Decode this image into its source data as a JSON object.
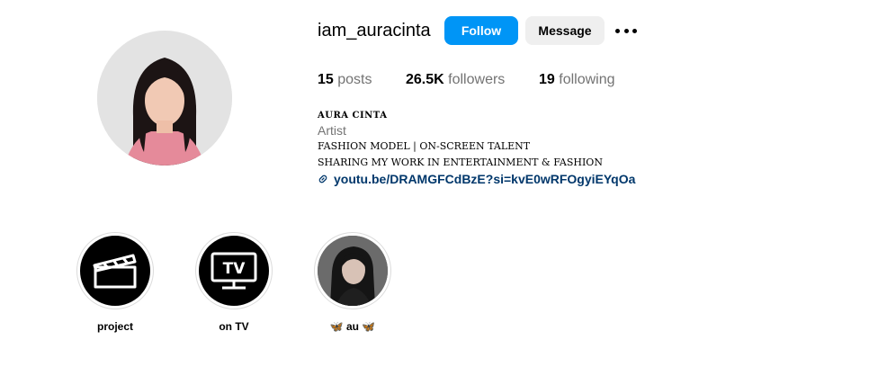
{
  "profile": {
    "username": "iam_auracinta",
    "follow_label": "Follow",
    "message_label": "Message"
  },
  "stats": {
    "posts_count": "15",
    "posts_label": "posts",
    "followers_count": "26.5K",
    "followers_label": "followers",
    "following_count": "19",
    "following_label": "following"
  },
  "bio": {
    "name": "AURA CINTA",
    "category": "Artist",
    "line1": "FASHION MODEL | ON-SCREEN TALENT",
    "line2": "SHARING MY WORK IN ENTERTAINMENT & FASHION",
    "link": "youtu.be/DRAMGFCdBzE?si=kvE0wRFOgyiEYqOa"
  },
  "highlights": [
    {
      "label": "project",
      "icon": "clapperboard-icon"
    },
    {
      "label": "on TV",
      "icon": "tv-icon"
    },
    {
      "label": "🦋 au 🦋",
      "icon": "photo"
    }
  ],
  "colors": {
    "follow_button": "#0095f6",
    "message_button": "#efefef",
    "link": "#00376b",
    "muted_text": "#737373"
  }
}
